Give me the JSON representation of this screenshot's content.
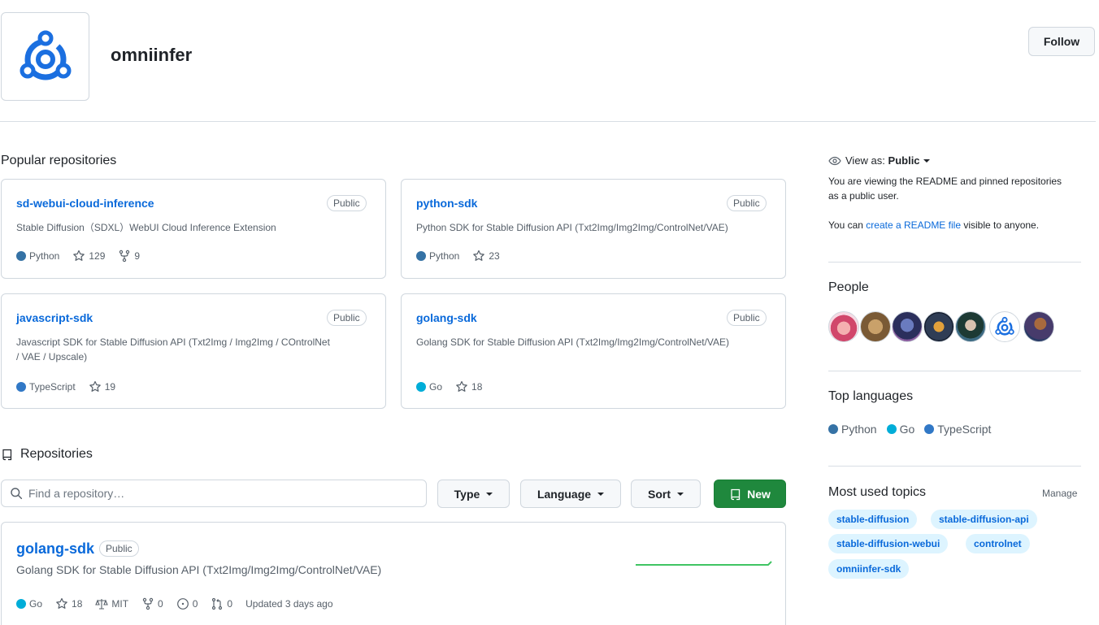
{
  "org": {
    "name": "omniinfer",
    "follow_label": "Follow"
  },
  "popular": {
    "title": "Popular repositories",
    "cards": [
      {
        "name": "sd-webui-cloud-inference",
        "visibility": "Public",
        "description": "Stable Diffusion（SDXL）WebUI Cloud Inference Extension",
        "language": "Python",
        "lang_color": "#3572A5",
        "stars": "129",
        "forks": "9"
      },
      {
        "name": "python-sdk",
        "visibility": "Public",
        "description": "Python SDK for Stable Diffusion API (Txt2Img/Img2Img/ControlNet/VAE)",
        "language": "Python",
        "lang_color": "#3572A5",
        "stars": "23"
      },
      {
        "name": "javascript-sdk",
        "visibility": "Public",
        "description": "Javascript SDK for Stable Diffusion API (Txt2Img / Img2Img / COntrolNet / VAE / Upscale)",
        "language": "TypeScript",
        "lang_color": "#3178c6",
        "stars": "19"
      },
      {
        "name": "golang-sdk",
        "visibility": "Public",
        "description": "Golang SDK for Stable Diffusion API (Txt2Img/Img2Img/ControlNet/VAE)",
        "language": "Go",
        "lang_color": "#00ADD8",
        "stars": "18"
      }
    ]
  },
  "repositories": {
    "heading": "Repositories",
    "search_placeholder": "Find a repository…",
    "type_label": "Type",
    "language_label": "Language",
    "sort_label": "Sort",
    "new_label": "New",
    "items": [
      {
        "name": "golang-sdk",
        "visibility": "Public",
        "description": "Golang SDK for Stable Diffusion API (Txt2Img/Img2Img/ControlNet/VAE)",
        "language": "Go",
        "lang_color": "#00ADD8",
        "stars": "18",
        "license": "MIT",
        "forks": "0",
        "issues": "0",
        "pulls": "0",
        "updated": "Updated 3 days ago"
      }
    ]
  },
  "sidebar": {
    "view_as_prefix": "View as:",
    "view_as_value": "Public",
    "readme_note": "You are viewing the README and pinned repositories as a public user.",
    "create_prefix": "You can",
    "create_link": "create a README file",
    "create_suffix": "visible to anyone.",
    "people_title": "People",
    "languages_title": "Top languages",
    "languages": [
      {
        "name": "Python",
        "color": "#3572A5"
      },
      {
        "name": "Go",
        "color": "#00ADD8"
      },
      {
        "name": "TypeScript",
        "color": "#3178c6"
      }
    ],
    "topics_title": "Most used topics",
    "manage_label": "Manage",
    "topics": [
      "stable-diffusion",
      "stable-diffusion-api",
      "stable-diffusion-webui",
      "controlnet",
      "omniinfer-sdk"
    ]
  },
  "colors": {
    "accent": "#0969da",
    "primary_button": "#1f883d",
    "topic_bg": "#ddf4ff"
  }
}
